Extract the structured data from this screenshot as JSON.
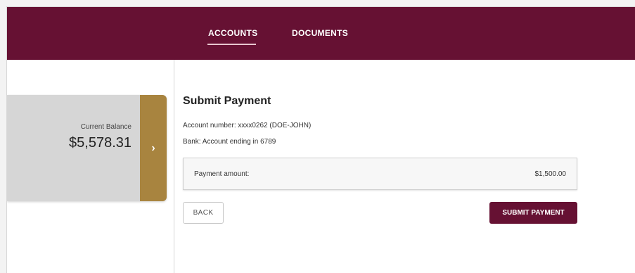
{
  "nav": {
    "tabs": [
      {
        "label": "ACCOUNTS",
        "active": true
      },
      {
        "label": "DOCUMENTS",
        "active": false
      }
    ]
  },
  "balance_card": {
    "label": "Current Balance",
    "amount": "$5,578.31",
    "arrow_glyph": "›"
  },
  "payment": {
    "title": "Submit Payment",
    "account_number": "Account number: xxxx0262 (DOE-JOHN)",
    "bank": "Bank: Account ending in 6789",
    "amount_label": "Payment amount:",
    "amount_value": "$1,500.00"
  },
  "buttons": {
    "back": "BACK",
    "submit": "SUBMIT PAYMENT"
  },
  "colors": {
    "header": "#661133",
    "accent_gold": "#a8843f",
    "card_gray": "#d6d6d6"
  }
}
